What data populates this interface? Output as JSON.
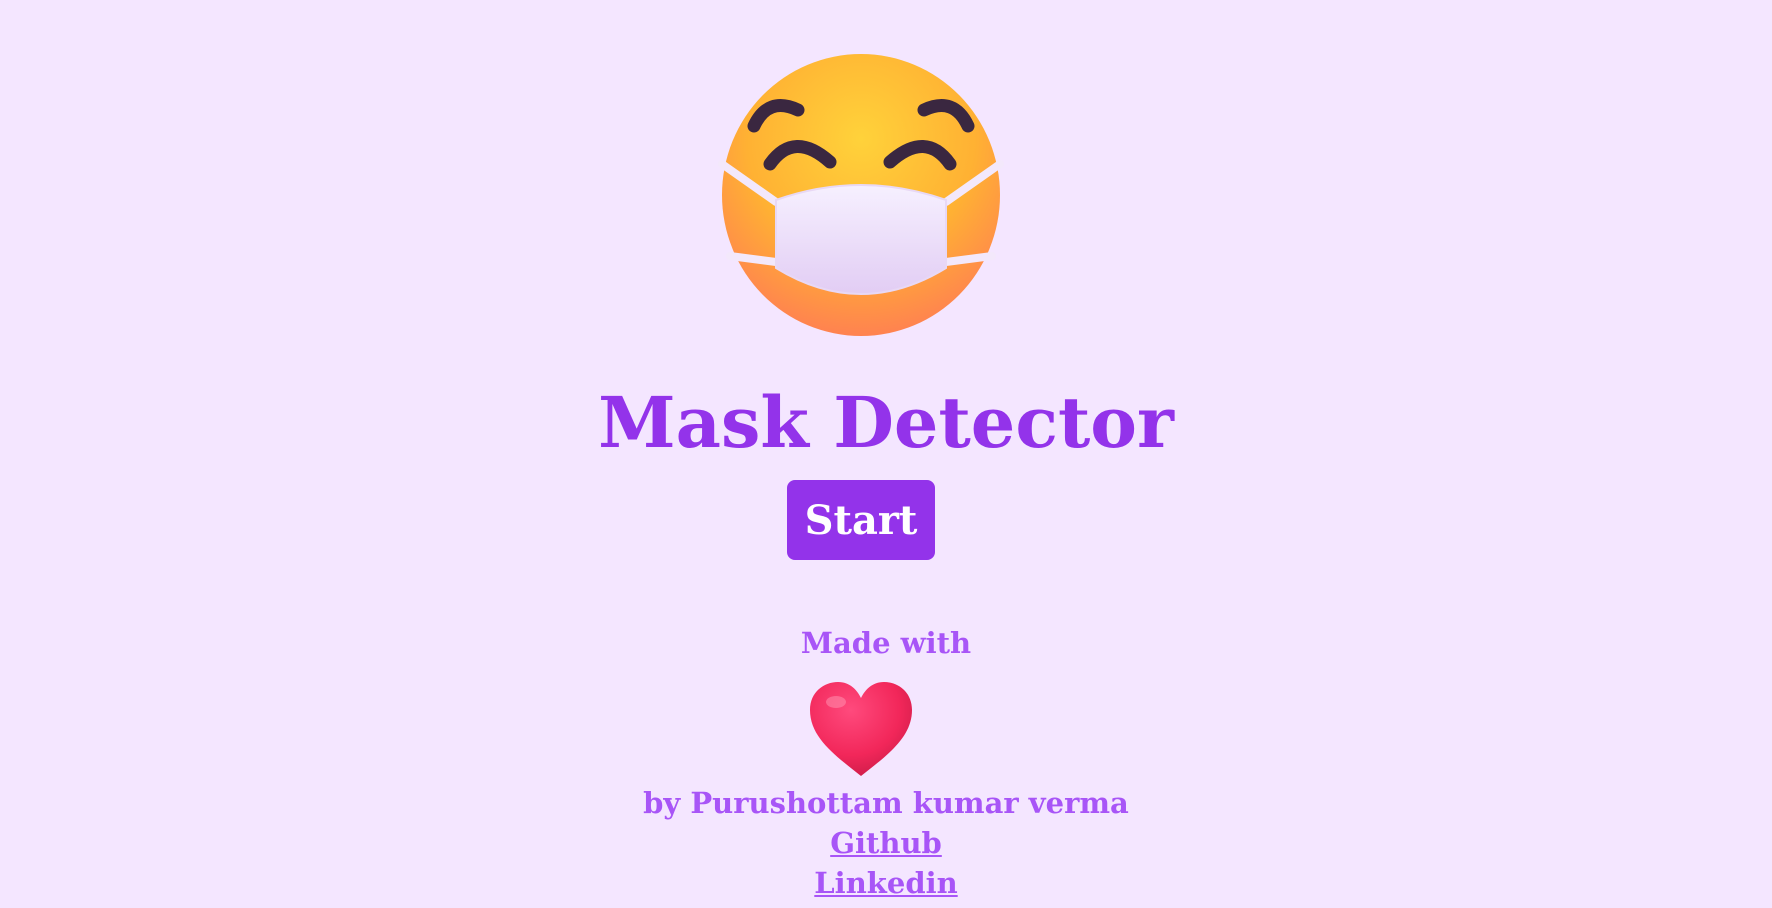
{
  "title": "Mask Detector",
  "start_label": "Start",
  "footer": {
    "made_with": "Made with",
    "byline": "by Purushottam kumar verma",
    "github_label": "Github",
    "linkedin_label": "Linkedin"
  },
  "icons": {
    "hero": "face-with-medical-mask-icon",
    "heart": "red-heart-icon"
  },
  "colors": {
    "background": "#f4e6ff",
    "accent": "#9333ea",
    "accent_light": "#a855f7",
    "button_text": "#ffffff"
  }
}
